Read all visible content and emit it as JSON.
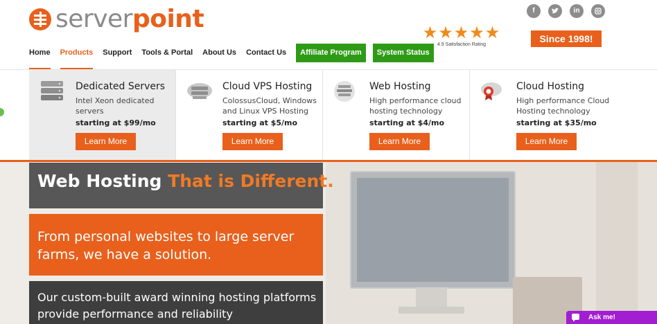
{
  "logo": {
    "part1": "server",
    "part2": "point"
  },
  "nav": {
    "items": [
      "Home",
      "Products",
      "Support",
      "Tools & Portal",
      "About Us",
      "Contact Us"
    ],
    "buttons": [
      "Affiliate Program",
      "System Status"
    ],
    "active_index": 1
  },
  "social": [
    "f",
    "t",
    "in",
    "o"
  ],
  "rating": {
    "stars": "★★★★★",
    "text": "4.9 Satisfaction Rating"
  },
  "since": "Since 1998!",
  "products": [
    {
      "title": "Dedicated Servers",
      "desc": "Intel Xeon dedicated servers",
      "price": "starting at $99/mo",
      "button": "Learn More",
      "icon": "server-stack-icon"
    },
    {
      "title": "Cloud VPS Hosting",
      "desc": "ColossusCloud, Windows and Linux VPS Hosting",
      "price": "starting at $5/mo",
      "button": "Learn More",
      "icon": "cloud-vps-icon"
    },
    {
      "title": "Web Hosting",
      "desc": "High performance cloud hosting technology",
      "price": "starting at $4/mo",
      "button": "Learn More",
      "icon": "web-globe-icon"
    },
    {
      "title": "Cloud Hosting",
      "desc": "High performance Cloud Hosting technology",
      "price": "starting at $35/mo",
      "button": "Learn More",
      "icon": "cloud-badge-icon"
    }
  ],
  "hero": {
    "headline_white": "Web Hosting ",
    "headline_orange": "That is Different.",
    "subtitle": "From personal websites to large server farms, we have a solution.",
    "body": "Our custom-built award winning hosting platforms provide performance and reliability"
  },
  "chat": {
    "label": "Ask me!"
  },
  "colors": {
    "orange": "#e8601c",
    "green": "#2e9b17",
    "purple": "#a21ed1"
  }
}
